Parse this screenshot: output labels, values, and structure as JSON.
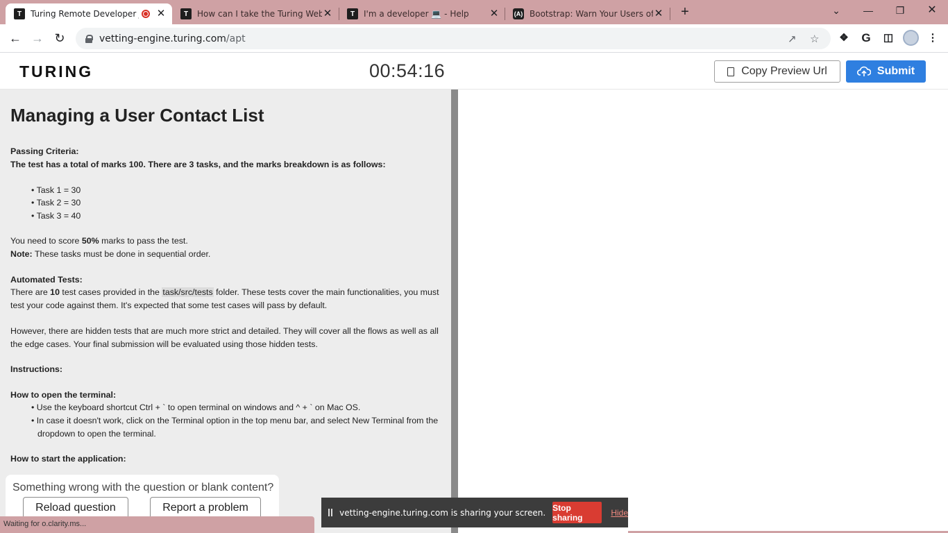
{
  "browser": {
    "tabs": [
      {
        "title": "Turing Remote Developer Jo",
        "icon": "turing-favicon",
        "recording": true,
        "active": true
      },
      {
        "title": "How can I take the Turing Web Fr",
        "icon": "turing-favicon",
        "active": false
      },
      {
        "title": "I'm a developer 💻 - Help",
        "icon": "turing-favicon",
        "active": false
      },
      {
        "title": "Bootstrap: Warn Your Users of a I",
        "icon": "bootstrap-favicon",
        "active": false
      }
    ],
    "url_host": "vetting-engine.turing.com",
    "url_path": "/apt",
    "new_tab_label": "+",
    "close_glyph": "✕"
  },
  "header": {
    "logo": "TURING",
    "timer": "00:54:16",
    "copy_preview_label": "Copy Preview Url",
    "submit_label": "Submit"
  },
  "question": {
    "title": "Managing a User Contact List",
    "passing_heading": "Passing Criteria:",
    "passing_text": "The test has a total of marks 100. There are 3 tasks, and the marks breakdown is as follows:",
    "tasks": [
      "Task 1 = 30",
      "Task 2 = 30",
      "Task 3 = 40"
    ],
    "score_pre": "You need to score ",
    "score_bold": "50%",
    "score_post": " marks to pass the test.",
    "note_label": "Note:",
    "note_text": " These tasks must be done in sequential order.",
    "auto_heading": "Automated Tests:",
    "auto_pre": "There are ",
    "auto_count": "10",
    "auto_mid": " test cases provided in the ",
    "auto_folder": "task/src/tests",
    "auto_post": " folder. These tests cover the main functionalities, you must test your code against them. It's expected that some test cases will pass by default.",
    "hidden_text": "However, there are hidden tests that are much more strict and detailed. They will cover all the flows as well as all the edge cases. Your final submission will be evaluated using those hidden tests.",
    "instructions_heading": "Instructions:",
    "terminal_heading": "How to open the terminal:",
    "terminal_steps": [
      "Use the keyboard shortcut Ctrl + ` to open terminal on windows and ^ + ` on Mac OS.",
      "In case it doesn't work, click on the Terminal option in the top menu bar, and select New Terminal from the dropdown to open the terminal."
    ],
    "start_heading": "How to start the application:"
  },
  "feedback": {
    "message": "Something wrong with the question or blank content?",
    "reload_label": "Reload question",
    "report_label": "Report a problem"
  },
  "status_bar": "Waiting for o.clarity.ms...",
  "screen_share": {
    "message": "vetting-engine.turing.com is sharing your screen.",
    "stop_label": "Stop sharing",
    "hide_label": "Hide"
  },
  "colors": {
    "chrome_frame": "#cfa1a4",
    "submit_blue": "#2f7fe0",
    "stop_red": "#d93c32"
  }
}
